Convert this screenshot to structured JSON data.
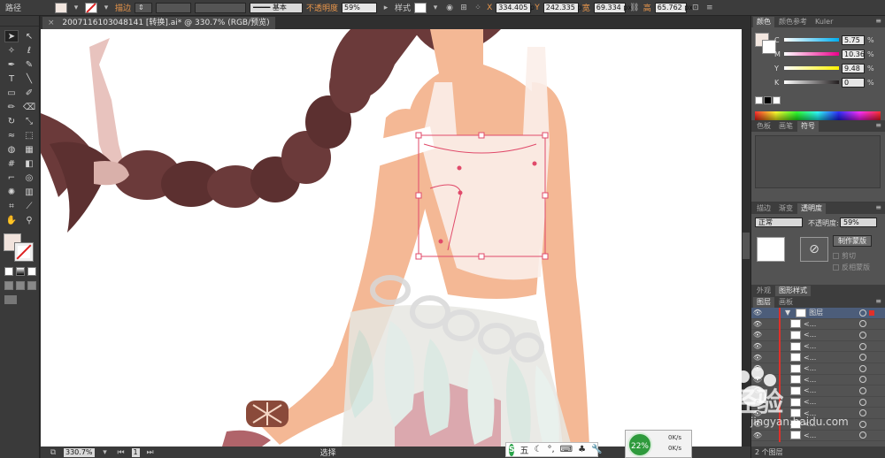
{
  "control_bar": {
    "mode_label": "路径",
    "stroke_label": "描边",
    "brush_label": "基本",
    "opacity_label": "不透明度",
    "opacity_value": "59%",
    "style_label": "样式",
    "x_label": "X",
    "x_value": "334.405 p",
    "y_label": "Y",
    "y_value": "242.335 p",
    "w_label": "宽",
    "w_value": "69.334 px",
    "h_label": "高",
    "h_value": "65.762 px"
  },
  "document": {
    "tab_title": "2007116103048141 [转换].ai* @ 330.7% (RGB/预览)",
    "close_glyph": "×"
  },
  "status_bar": {
    "zoom": "330.7%",
    "page": "1",
    "tool_status": "选择"
  },
  "ime": {
    "logo": "S",
    "mode": "五",
    "glyphs": [
      "☾",
      "°,",
      "⌨",
      "♣",
      "👕",
      "🔧"
    ]
  },
  "network": {
    "percent": "22%",
    "up": "0K/s",
    "down": "0K/s"
  },
  "color_panel": {
    "tabs": [
      "颜色",
      "颜色参考",
      "Kuler"
    ],
    "channels": [
      {
        "label": "C",
        "value": "5.75",
        "color": "#00aeef"
      },
      {
        "label": "M",
        "value": "10.36",
        "color": "#ec008c"
      },
      {
        "label": "Y",
        "value": "9.48",
        "color": "#fff200"
      },
      {
        "label": "K",
        "value": "0",
        "color": "#231f20"
      }
    ],
    "percent": "%"
  },
  "swatch_panel": {
    "tabs": [
      "色板",
      "画笔",
      "符号"
    ]
  },
  "transparency_panel": {
    "tabs": [
      "描边",
      "渐变",
      "透明度"
    ],
    "blend_mode": "正常",
    "opacity_label": "不透明度:",
    "opacity_value": "59%",
    "make_mask_button": "制作蒙版",
    "clip_label": "剪切",
    "invert_label": "反相蒙版"
  },
  "appearance_panel": {
    "tabs": [
      "外观",
      "图形样式"
    ]
  },
  "layers_panel": {
    "tabs": [
      "图层",
      "画板"
    ],
    "top_layer": "图层",
    "sublayer_name": "<...",
    "footer": "2 个图层"
  },
  "watermark": {
    "brand": "Bai经验",
    "url": "jingyan.baidu.com"
  },
  "colors": {
    "skin": "#f4b895",
    "hair": "#6b3a3a",
    "ribbon": "#e8c3be",
    "selection": "#e04a6a",
    "accent_red": "#e0302a"
  }
}
